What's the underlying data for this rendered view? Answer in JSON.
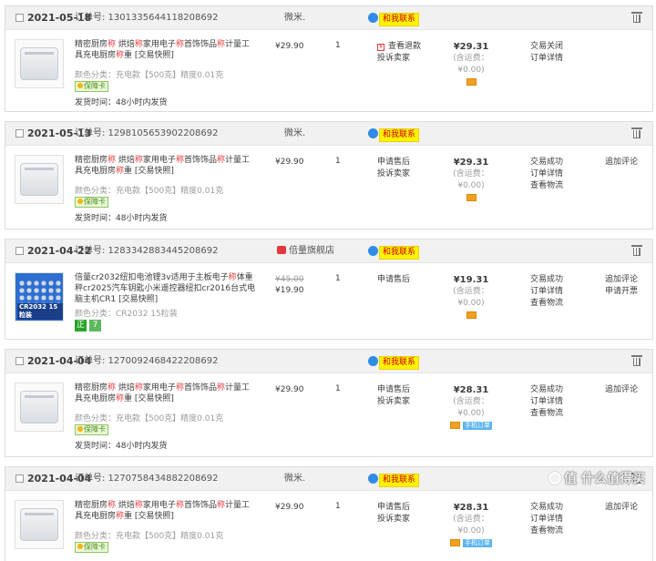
{
  "labels": {
    "order_no_prefix": "订单号:",
    "ship_prefix": "发货时间：",
    "spec_prefix": "颜色分类：",
    "contact": "和我联系",
    "tax_note": "(含运费：¥0.00)"
  },
  "orders": [
    {
      "date": "2021-05-18",
      "order_no": "1301335644118208692",
      "shop": "微米.",
      "title": [
        "精密厨房",
        "称",
        " 烘焙",
        "称",
        "家用电子",
        "称",
        "首饰饰品",
        "称",
        "计量工具充电厨房",
        "称",
        "重 [交易快照]"
      ],
      "spec": "充电款【500克】精度0.01克",
      "badge": "保障卡",
      "ship": "48小时内发货",
      "price": "¥29.90",
      "price_orig": "",
      "qty": "1",
      "svc": [
        "查看退款",
        "投诉卖家"
      ],
      "total": "¥29.31",
      "status": [
        "交易关闭",
        "订单详情"
      ],
      "actions": [],
      "pay_blue": ""
    },
    {
      "date": "2021-05-13",
      "order_no": "1298105653902208692",
      "shop": "微米.",
      "title": [
        "精密厨房",
        "称",
        " 烘焙",
        "称",
        "家用电子",
        "称",
        "首饰饰品",
        "称",
        "计量工具充电厨房",
        "称",
        "重 [交易快照]"
      ],
      "spec": "充电款【500克】精度0.01克",
      "badge": "保障卡",
      "ship": "48小时内发货",
      "price": "¥29.90",
      "price_orig": "",
      "qty": "1",
      "svc": [
        "申请售后",
        "投诉卖家"
      ],
      "total": "¥29.31",
      "status": [
        "交易成功",
        "订单详情",
        "查看物流"
      ],
      "actions": [
        "追加评论"
      ],
      "pay_blue": ""
    },
    {
      "date": "2021-04-22",
      "order_no": "1283342883445208692",
      "shop": "倍量旗舰店",
      "title": [
        "倍量cr2032纽扣电池锂3v适用于主板电子",
        "称",
        "体重秤cr2025汽车钥匙小米遥控器纽扣cr2016台式电脑主机CR1 [交易快照]"
      ],
      "spec": "CR2032 15粒装",
      "badge": "",
      "ship": "",
      "price": "¥19.90",
      "price_orig": "¥45.00",
      "qty": "1",
      "svc": [
        "申请售后"
      ],
      "total": "¥19.31",
      "status": [
        "交易成功",
        "订单详情",
        "查看物流"
      ],
      "actions": [
        "追加评论",
        "申请开票"
      ],
      "pay_blue": "",
      "thumb_tag": "CR2032 15粒装",
      "badges2": [
        "正",
        "7"
      ]
    },
    {
      "date": "2021-04-04",
      "order_no": "1270092468422208692",
      "shop": "",
      "title": [
        "精密厨房",
        "称",
        " 烘焙",
        "称",
        "家用电子",
        "称",
        "首饰饰品",
        "称",
        "计量工具充电厨房",
        "称",
        "重 [交易快照]"
      ],
      "spec": "充电款【500克】精度0.01克",
      "badge": "保障卡",
      "ship": "48小时内发货",
      "price": "¥29.90",
      "price_orig": "",
      "qty": "1",
      "svc": [
        "申请售后",
        "投诉卖家"
      ],
      "total": "¥28.31",
      "status": [
        "交易成功",
        "订单详情",
        "查看物流"
      ],
      "actions": [
        "追加评论"
      ],
      "pay_blue": "手机订单"
    },
    {
      "date": "2021-04-04",
      "order_no": "1270758434882208692",
      "shop": "微米.",
      "title": [
        "精密厨房",
        "称",
        " 烘焙",
        "称",
        "家用电子",
        "称",
        "首饰饰品",
        "称",
        "计量工具充电厨房",
        "称",
        "重 [交易快照]"
      ],
      "spec": "充电款【500克】精度0.01克",
      "badge": "保障卡",
      "ship": "",
      "price": "¥29.90",
      "price_orig": "",
      "qty": "1",
      "svc": [
        "申请售后",
        "投诉卖家"
      ],
      "total": "¥28.31",
      "status": [
        "交易成功",
        "订单详情",
        "查看物流"
      ],
      "actions": [
        "追加评论"
      ],
      "pay_blue": "手机订单"
    }
  ],
  "watermark": "值 什么值得买",
  "colors": {
    "accent_red": "#e4393c",
    "contact_yellow": "#fff200",
    "header_bg": "#f1f1f1"
  }
}
